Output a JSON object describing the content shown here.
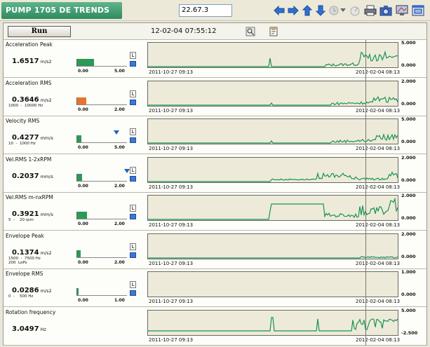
{
  "window": {
    "title": "PUMP 1705 DE   TRENDS",
    "value_field": "22.67.3"
  },
  "toolbar": {
    "icons": [
      "arrow-left-icon",
      "arrow-right-icon",
      "arrow-up-icon",
      "arrow-down-icon",
      "history-icon",
      "dropdown-icon",
      "gauge-icon",
      "print-icon",
      "camera-icon",
      "screen-icon",
      "window-icon"
    ]
  },
  "header": {
    "run_label": "Run",
    "datetime": "12-02-04 07:55:12"
  },
  "chart_data": [
    {
      "type": "line",
      "title": "Acceleration Peak",
      "value": "1.6517",
      "unit": "m/s2",
      "range": "",
      "bar_fill": 0.33,
      "bar_color": "#2b9a57",
      "bar_scale": [
        "0.00",
        "5.00"
      ],
      "marker": null,
      "ylim": [
        "",
        "5.000"
      ],
      "y_top": "5.000",
      "y_bottom": "0.000",
      "x_start": "2011-10-27 09:13",
      "x_end": "2012-02-04 08:13",
      "pattern": "late"
    },
    {
      "type": "line",
      "title": "Acceleration RMS",
      "value": "0.3646",
      "unit": "m/s2",
      "range": "1000  -  10000 Hz",
      "bar_fill": 0.18,
      "bar_color": "#e8732c",
      "bar_scale": [
        "0.00",
        "2.00"
      ],
      "marker": null,
      "y_top": "2.000",
      "y_bottom": "0.000",
      "x_start": "2011-10-27 09:13",
      "x_end": "2012-02-04 08:13",
      "pattern": "low"
    },
    {
      "type": "line",
      "title": "Velocity RMS",
      "value": "0.4277",
      "unit": "mm/s",
      "range": "10  -  1000 Hz",
      "bar_fill": 0.09,
      "bar_color": "#2b9a57",
      "bar_scale": [
        "0.00",
        "5.00"
      ],
      "marker": 0.78,
      "y_top": "5.000",
      "y_bottom": "0.000",
      "x_start": "2011-10-27 09:13",
      "x_end": "2012-02-04 08:13",
      "pattern": "low"
    },
    {
      "type": "line",
      "title": "Vel.RMS 1-2xRPM",
      "value": "0.2037",
      "unit": "mm/s",
      "range": "",
      "bar_fill": 0.1,
      "bar_color": "#2b9a57",
      "bar_scale": [
        "0.00",
        "2.00"
      ],
      "marker": 0.98,
      "y_top": "2.000",
      "y_bottom": "0.000",
      "x_start": "2011-10-27 09:13",
      "x_end": "2012-02-04 08:13",
      "pattern": "mid"
    },
    {
      "type": "line",
      "title": "Vel.RMS m-nxRPM",
      "value": "0.3921",
      "unit": "mm/s",
      "range": "5  -    20 rpm",
      "bar_fill": 0.2,
      "bar_color": "#2b9a57",
      "bar_scale": [
        "0.00",
        "2.00"
      ],
      "marker": null,
      "y_top": "2.000",
      "y_bottom": "0.000",
      "x_start": "2011-10-27 09:13",
      "x_end": "2012-02-04 08:13",
      "pattern": "step"
    },
    {
      "type": "line",
      "title": "Envelope Peak",
      "value": "0.1374",
      "unit": "m/s2",
      "range": "1500  -  7500 Hz\n200  LoPs",
      "bar_fill": 0.07,
      "bar_color": "#2b9a57",
      "bar_scale": [
        "0.00",
        "2.00"
      ],
      "marker": null,
      "y_top": "2.000",
      "y_bottom": "0.000",
      "x_start": "2011-10-27 09:13",
      "x_end": "2012-02-04 08:13",
      "pattern": "flat"
    },
    {
      "type": "line",
      "title": "Envelope RMS",
      "value": "0.0286",
      "unit": "m/s2",
      "range": "0  -    500 Hz",
      "bar_fill": 0.03,
      "bar_color": "#2b9a57",
      "bar_scale": [
        "0.00",
        "1.00"
      ],
      "marker": null,
      "y_top": "1.000",
      "y_bottom": "0.000",
      "x_start": "2011-10-27 09:13",
      "x_end": "2012-02-04 08:13",
      "pattern": "none"
    },
    {
      "type": "line",
      "title": "Rotation frequency",
      "value": "3.0497",
      "unit": "Hz",
      "range": "",
      "bar_fill": null,
      "bar_color": "#2b9a57",
      "bar_scale": [
        "",
        ""
      ],
      "marker": null,
      "y_top": "5.000",
      "y_bottom": "-2.500",
      "x_start": "2011-10-27 09:13",
      "x_end": "2012-02-04 08:13",
      "pattern": "rot"
    }
  ]
}
